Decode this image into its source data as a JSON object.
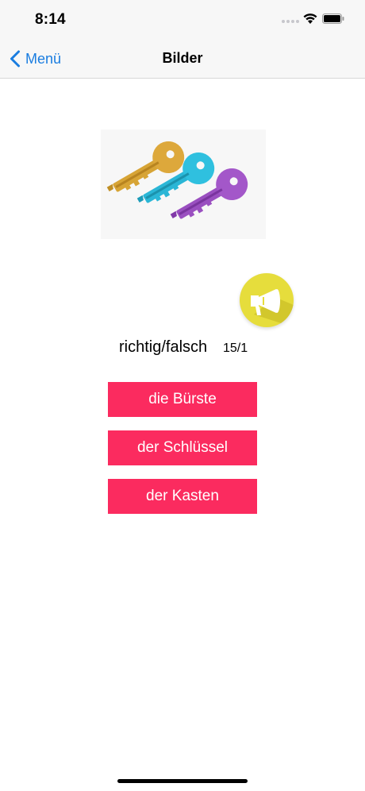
{
  "status_bar": {
    "time": "8:14"
  },
  "nav": {
    "back_label": "Menü",
    "title": "Bilder"
  },
  "picture": {
    "subject": "three keys (yellow, blue, purple)"
  },
  "quiz": {
    "status_label": "richtig/falsch",
    "score": "15/1"
  },
  "answers": [
    {
      "label": "die Bürste"
    },
    {
      "label": "der Schlüssel"
    },
    {
      "label": "der Kasten"
    }
  ],
  "colors": {
    "accent_blue": "#1a7de0",
    "answer_button": "#fb2b5f",
    "speaker_button": "#e6dd3c"
  },
  "icons": {
    "back": "chevron-left-icon",
    "speaker": "megaphone-icon",
    "wifi": "wifi-icon",
    "battery": "battery-icon"
  }
}
